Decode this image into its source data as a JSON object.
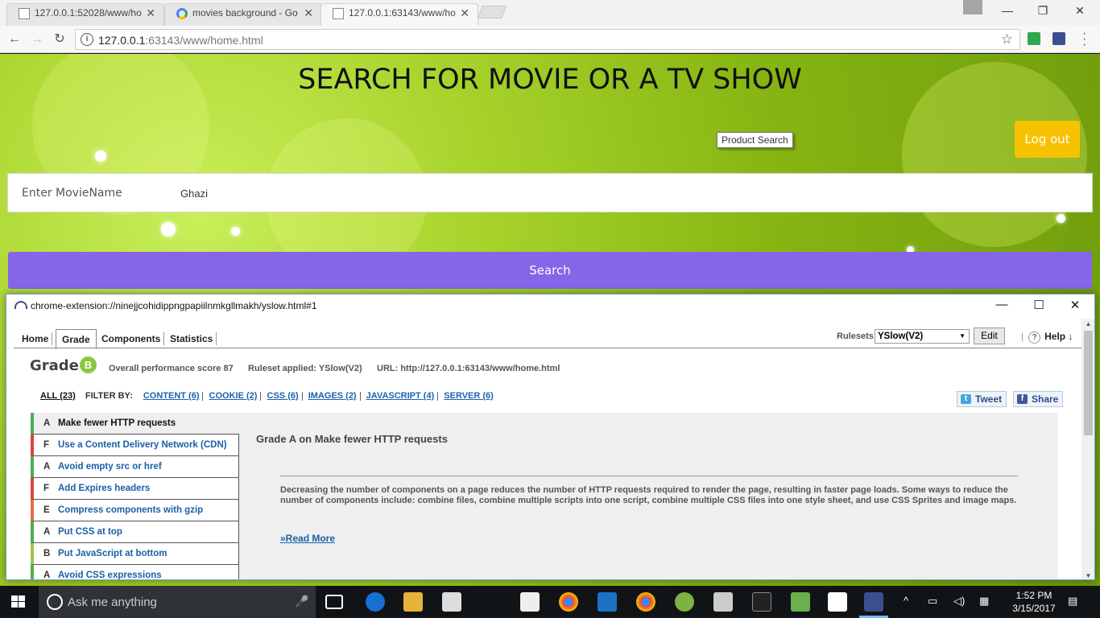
{
  "browser": {
    "tabs": [
      {
        "title": "127.0.0.1:52028/www/ho",
        "icon": "document-icon"
      },
      {
        "title": "movies background - Go",
        "icon": "google-icon"
      },
      {
        "title": "127.0.0.1:63143/www/ho",
        "icon": "document-icon"
      }
    ],
    "url_host": "127.0.0.1",
    "url_rest": ":63143/www/home.html",
    "close_glyph": "✕"
  },
  "page": {
    "title": "SEARCH FOR MOVIE OR A TV SHOW",
    "tooltip": "Product Search",
    "logout_label": "Log out",
    "search_label": "Enter MovieName",
    "search_value": "Ghazi",
    "search_button": "Search",
    "colors": {
      "accent_button": "#8665e8",
      "logout": "#f7c200",
      "background": "#8ab816"
    }
  },
  "yslow": {
    "window_title": "chrome-extension://ninejjcohidippngpapiilnmkgllmakh/yslow.html#1",
    "tabs": [
      "Home",
      "Grade",
      "Components",
      "Statistics"
    ],
    "active_tab": "Grade",
    "rulesets_label": "Rulesets",
    "ruleset_value": "YSlow(V2)",
    "edit_label": "Edit",
    "help_label": "Help ↓",
    "grade_label": "Grade",
    "grade_value": "B",
    "overall_score": "Overall performance score 87",
    "ruleset_applied": "Ruleset applied: YSlow(V2)",
    "url": "URL: http://127.0.0.1:63143/www/home.html",
    "filter_all": "ALL (23)",
    "filter_by": "FILTER BY:",
    "filters": [
      "CONTENT (6)",
      "COOKIE (2)",
      "CSS (6)",
      "IMAGES (2)",
      "JAVASCRIPT (4)",
      "SERVER (6)"
    ],
    "tweet_label": "Tweet",
    "share_label": "Share",
    "rules": [
      {
        "grade": "A",
        "title": "Make fewer HTTP requests"
      },
      {
        "grade": "F",
        "title": "Use a Content Delivery Network (CDN)"
      },
      {
        "grade": "A",
        "title": "Avoid empty src or href"
      },
      {
        "grade": "F",
        "title": "Add Expires headers"
      },
      {
        "grade": "E",
        "title": "Compress components with gzip"
      },
      {
        "grade": "A",
        "title": "Put CSS at top"
      },
      {
        "grade": "B",
        "title": "Put JavaScript at bottom"
      },
      {
        "grade": "A",
        "title": "Avoid CSS expressions"
      }
    ],
    "detail_title": "Grade A on Make fewer HTTP requests",
    "detail_text": "Decreasing the number of components on a page reduces the number of HTTP requests required to render the page, resulting in faster page loads. Some ways to reduce the number of components include: combine files, combine multiple scripts into one script, combine multiple CSS files into one style sheet, and use CSS Sprites and image maps.",
    "read_more": "»Read More"
  },
  "taskbar": {
    "search_placeholder": "Ask me anything",
    "time": "1:52 PM",
    "date": "3/15/2017"
  }
}
